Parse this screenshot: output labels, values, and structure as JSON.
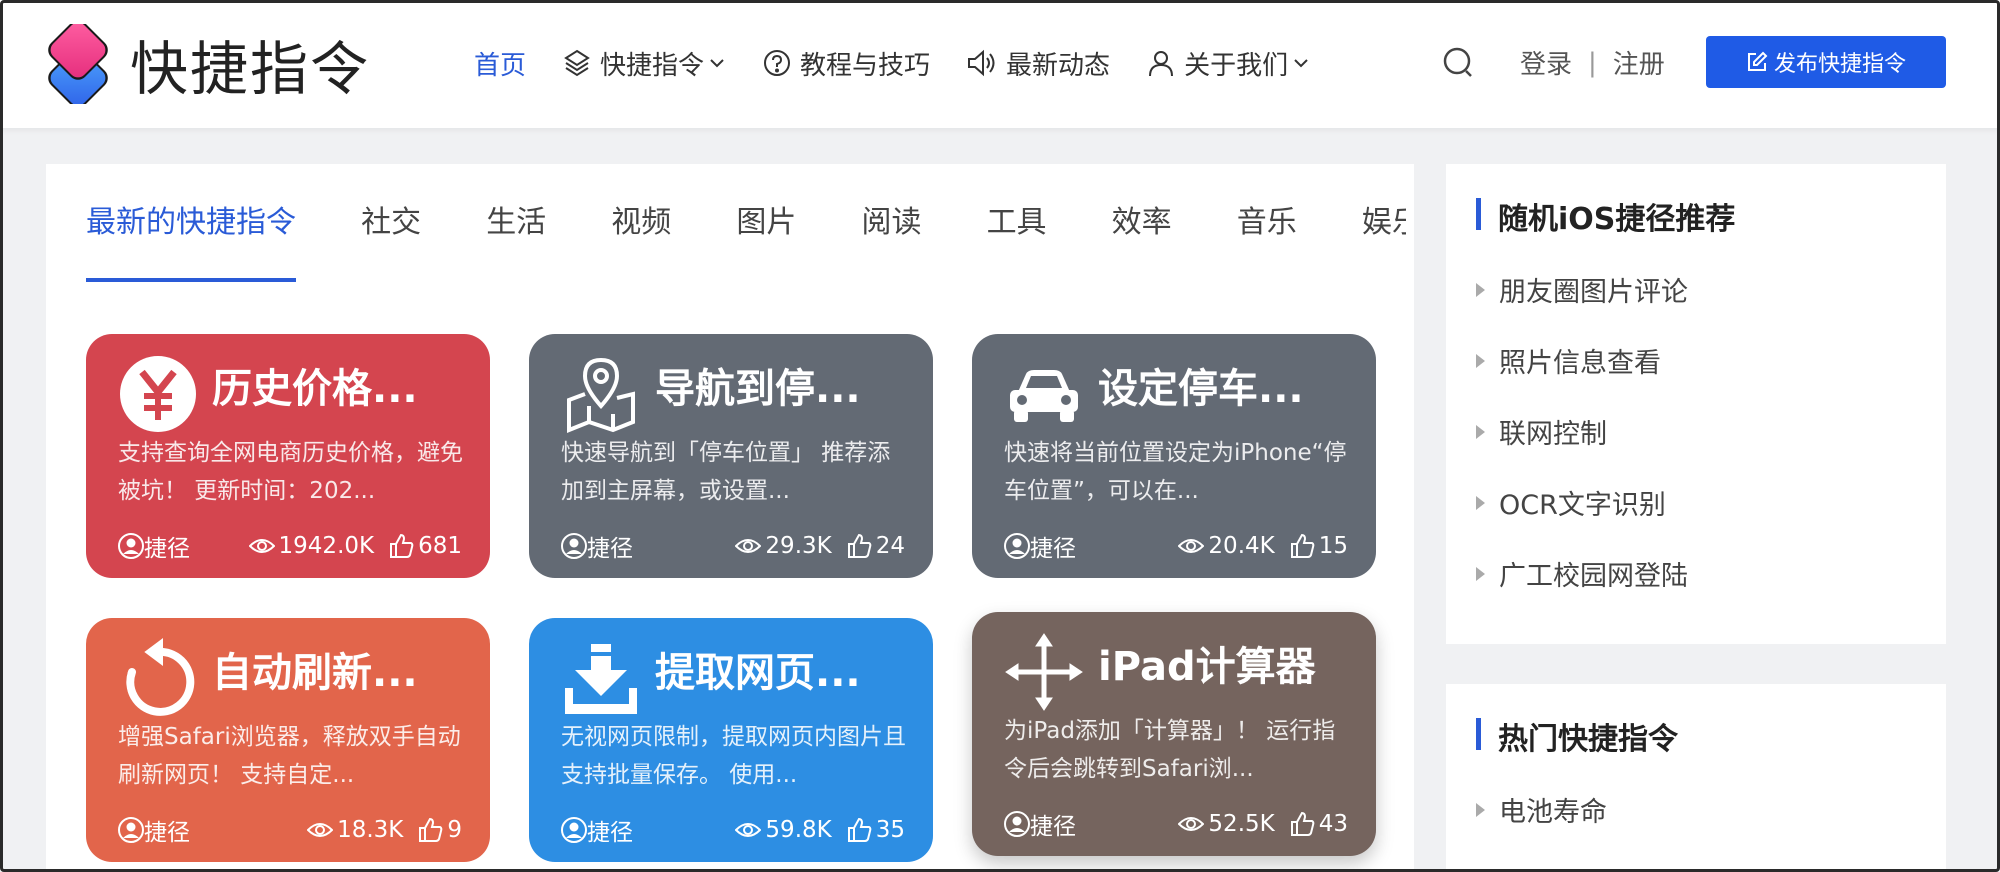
{
  "header": {
    "logo_text": "快捷指令",
    "nav": [
      {
        "label": "首页",
        "icon": "none",
        "active": true
      },
      {
        "label": "快捷指令",
        "icon": "layers-icon",
        "dropdown": true
      },
      {
        "label": "教程与技巧",
        "icon": "question-icon"
      },
      {
        "label": "最新动态",
        "icon": "speaker-icon"
      },
      {
        "label": "关于我们",
        "icon": "user-icon",
        "dropdown": true
      }
    ],
    "login": "登录",
    "sep": "|",
    "register": "注册",
    "publish": "发布快捷指令"
  },
  "tabs": [
    "最新的快捷指令",
    "社交",
    "生活",
    "视频",
    "图片",
    "阅读",
    "工具",
    "效率",
    "音乐",
    "娱乐"
  ],
  "cards": [
    {
      "title": "历史价格...",
      "desc": "支持查询全网电商历史价格，避免被坑！ 更新时间：202...",
      "author": "捷径",
      "views": "1942.0K",
      "likes": "681",
      "color": "#d4454f",
      "icon": "yen-icon"
    },
    {
      "title": "导航到停...",
      "desc": "快速导航到「停车位置」 推荐添加到主屏幕，或设置...",
      "author": "捷径",
      "views": "29.3K",
      "likes": "24",
      "color": "#636a74",
      "icon": "map-pin-icon"
    },
    {
      "title": "设定停车...",
      "desc": "快速将当前位置设定为iPhone“停车位置”，可以在...",
      "author": "捷径",
      "views": "20.4K",
      "likes": "15",
      "color": "#636a74",
      "icon": "car-icon"
    },
    {
      "title": "自动刷新...",
      "desc": "增强Safari浏览器，释放双手自动刷新网页！ 支持自定...",
      "author": "捷径",
      "views": "18.3K",
      "likes": "9",
      "color": "#e2654b",
      "icon": "refresh-icon"
    },
    {
      "title": "提取网页...",
      "desc": "无视网页限制，提取网页内图片且支持批量保存。 使用...",
      "author": "捷径",
      "views": "59.8K",
      "likes": "35",
      "color": "#2d8ee3",
      "icon": "download-icon"
    },
    {
      "title": "iPad计算器",
      "desc": "为iPad添加「计算器」！ 运行指令后会跳转到Safari浏...",
      "author": "捷径",
      "views": "52.5K",
      "likes": "43",
      "color": "#75645e",
      "icon": "move-arrows-icon"
    }
  ],
  "sidebar": {
    "random_title": "随机iOS捷径推荐",
    "random_items": [
      "朋友圈图片评论",
      "照片信息查看",
      "联网控制",
      "OCR文字识别",
      "广工校园网登陆"
    ],
    "hot_title": "热门快捷指令",
    "hot_items": [
      "电池寿命"
    ]
  }
}
